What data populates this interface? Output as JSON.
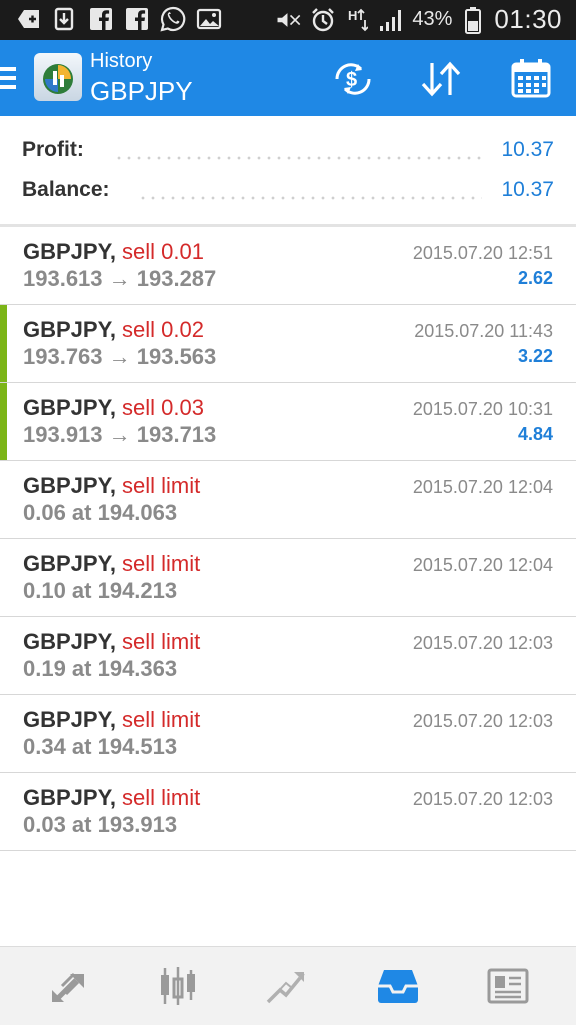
{
  "status_bar": {
    "battery": "43%",
    "time": "01:30",
    "left_icons": [
      "add-box-icon",
      "download-icon",
      "facebook-icon",
      "facebook-icon",
      "whatsapp-icon",
      "image-icon"
    ],
    "right_icons": [
      "mute-icon",
      "alarm-icon",
      "network-h-icon",
      "signal-icon",
      "battery-icon"
    ]
  },
  "appbar": {
    "subtitle": "History",
    "title": "GBPJPY",
    "color": "#1f88e5",
    "actions": [
      "currency-exchange-icon",
      "sort-icon",
      "calendar-icon"
    ]
  },
  "summary": {
    "profit_label": "Profit:",
    "profit_value": "10.37",
    "balance_label": "Balance:",
    "balance_value": "10.37"
  },
  "rows": [
    {
      "symbol": "GBPJPY,",
      "type": "sell 0.01",
      "detail": "193.613 → 193.287",
      "time": "2015.07.20 12:51",
      "profit": "2.62",
      "bar": false
    },
    {
      "symbol": "GBPJPY,",
      "type": "sell 0.02",
      "detail": "193.763 → 193.563",
      "time": "2015.07.20 11:43",
      "profit": "3.22",
      "bar": true
    },
    {
      "symbol": "GBPJPY,",
      "type": "sell 0.03",
      "detail": "193.913 → 193.713",
      "time": "2015.07.20 10:31",
      "profit": "4.84",
      "bar": true
    },
    {
      "symbol": "GBPJPY,",
      "type": "sell limit",
      "detail": "0.06 at 194.063",
      "time": "2015.07.20 12:04",
      "profit": "",
      "bar": false
    },
    {
      "symbol": "GBPJPY,",
      "type": "sell limit",
      "detail": "0.10 at 194.213",
      "time": "2015.07.20 12:04",
      "profit": "",
      "bar": false
    },
    {
      "symbol": "GBPJPY,",
      "type": "sell limit",
      "detail": "0.19 at 194.363",
      "time": "2015.07.20 12:03",
      "profit": "",
      "bar": false
    },
    {
      "symbol": "GBPJPY,",
      "type": "sell limit",
      "detail": "0.34 at 194.513",
      "time": "2015.07.20 12:03",
      "profit": "",
      "bar": false
    },
    {
      "symbol": "GBPJPY,",
      "type": "sell limit",
      "detail": "0.03 at 193.913",
      "time": "2015.07.20 12:03",
      "profit": "",
      "bar": false
    }
  ],
  "bottom_nav": [
    {
      "icon": "quotes-icon",
      "active": false
    },
    {
      "icon": "chart-icon",
      "active": false
    },
    {
      "icon": "trade-icon",
      "active": false
    },
    {
      "icon": "history-inbox-icon",
      "active": true
    },
    {
      "icon": "news-icon",
      "active": false
    }
  ],
  "colors": {
    "accent": "#1f88e5",
    "sell": "#d42a2a",
    "profit": "#1f7fd8",
    "closed_bar": "#7cb518"
  }
}
